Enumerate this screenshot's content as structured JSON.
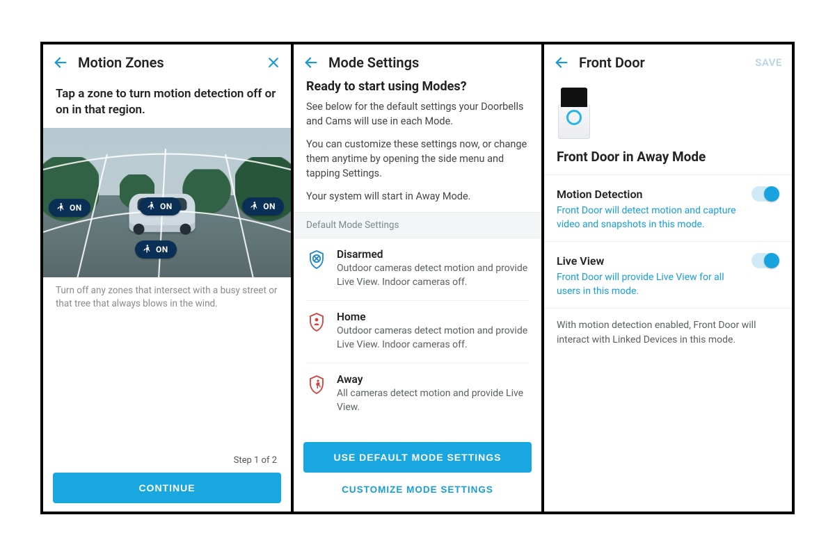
{
  "colors": {
    "accent": "#1aa6df",
    "link": "#159ed8",
    "pill": "#0a2f55",
    "shieldBlue": "#1e87c8",
    "shieldRed": "#d4403a"
  },
  "screen1": {
    "title": "Motion Zones",
    "instruction": "Tap a zone to turn motion detection off or on in that region.",
    "zones": [
      {
        "label": "ON"
      },
      {
        "label": "ON"
      },
      {
        "label": "ON"
      },
      {
        "label": "ON"
      }
    ],
    "hint": "Turn off any zones that intersect with a busy street or that tree that always blows in the wind.",
    "step": "Step 1 of 2",
    "continue": "CONTINUE"
  },
  "screen2": {
    "title": "Mode Settings",
    "heading": "Ready to start using Modes?",
    "p1": "See below for the default settings your Doorbells and Cams will use in each Mode.",
    "p2": "You can customize these settings now, or change them anytime by opening the side menu and tapping Settings.",
    "p3": "Your system will start in Away Mode.",
    "sectionLabel": "Default Mode Settings",
    "modes": [
      {
        "name": "Disarmed",
        "desc": "Outdoor cameras detect motion and provide Live View. Indoor cameras off.",
        "color": "#1e87c8",
        "icon": "x"
      },
      {
        "name": "Home",
        "desc": "Outdoor cameras detect motion and provide Live View. Indoor cameras off.",
        "color": "#d4403a",
        "icon": "person"
      },
      {
        "name": "Away",
        "desc": "All cameras detect motion and provide Live View.",
        "color": "#d4403a",
        "icon": "runner"
      }
    ],
    "primary": "USE DEFAULT MODE SETTINGS",
    "secondary": "CUSTOMIZE MODE SETTINGS"
  },
  "screen3": {
    "title": "Front Door",
    "save": "SAVE",
    "heading": "Front Door in Away Mode",
    "settings": [
      {
        "title": "Motion Detection",
        "desc": "Front Door will detect motion and capture video and snapshots in this mode.",
        "on": true
      },
      {
        "title": "Live View",
        "desc": "Front Door will provide Live View for all users in this mode.",
        "on": true
      }
    ],
    "note": "With motion detection enabled, Front Door will interact with Linked Devices in this mode."
  }
}
